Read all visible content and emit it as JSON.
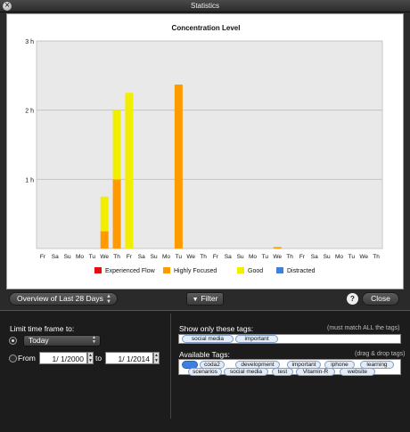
{
  "window": {
    "title": "Statistics"
  },
  "chart_data": {
    "type": "bar",
    "stacked": true,
    "title": "Concentration Level",
    "categories": [
      "Fr",
      "Sa",
      "Su",
      "Mo",
      "Tu",
      "We",
      "Th",
      "Fr",
      "Sa",
      "Su",
      "Mo",
      "Tu",
      "We",
      "Th",
      "Fr",
      "Sa",
      "Su",
      "Mo",
      "Tu",
      "We",
      "Th",
      "Fr",
      "Sa",
      "Su",
      "Mo",
      "Tu",
      "We",
      "Th"
    ],
    "series": [
      {
        "name": "Experienced Flow",
        "color": "#e01010",
        "values": [
          0,
          0,
          0,
          0,
          0,
          0,
          0,
          0,
          0,
          0,
          0,
          0,
          0,
          0,
          0,
          0,
          0,
          0,
          0,
          0,
          0,
          0,
          0,
          0,
          0,
          0,
          0,
          0
        ]
      },
      {
        "name": "Highly Focused",
        "color": "#ff9a00",
        "values": [
          0,
          0,
          0,
          0,
          0,
          0.25,
          1.0,
          0,
          0,
          0,
          0,
          2.37,
          0,
          0,
          0,
          0,
          0,
          0,
          0,
          0.02,
          0,
          0,
          0,
          0,
          0,
          0,
          0,
          0
        ]
      },
      {
        "name": "Good",
        "color": "#f2ee00",
        "values": [
          0,
          0,
          0,
          0,
          0,
          0.5,
          1.0,
          2.25,
          0,
          0,
          0,
          0,
          0,
          0,
          0,
          0,
          0,
          0,
          0,
          0,
          0,
          0,
          0,
          0,
          0,
          0,
          0,
          0
        ]
      },
      {
        "name": "Distracted",
        "color": "#3f7fe0",
        "values": [
          0,
          0,
          0,
          0,
          0,
          0,
          0,
          0,
          0,
          0,
          0,
          0,
          0,
          0,
          0,
          0,
          0,
          0,
          0,
          0,
          0,
          0,
          0,
          0,
          0,
          0,
          0,
          0
        ]
      }
    ],
    "yticks": [
      "1 h",
      "2 h",
      "3 h"
    ],
    "ytick_values": [
      1,
      2,
      3
    ],
    "ylim": [
      0,
      3
    ],
    "grid": true,
    "legend": "bottom"
  },
  "toolbar": {
    "overview_label": "Overview of Last 28 Days",
    "filter_label": "Filter",
    "help_label": "?",
    "close_label": "Close"
  },
  "timeframe": {
    "heading": "Limit time frame to:",
    "preset_value": "Today",
    "from_label": "From",
    "from_value": "1/ 1/2000",
    "to_label": "to",
    "to_value": "1/ 1/2014"
  },
  "tags": {
    "filter_heading": "Show only these tags:",
    "filter_hint": "(must match ALL the tags)",
    "filter_tags": [
      "social media",
      "important"
    ],
    "available_heading": "Available Tags:",
    "available_hint": "(drag & drop tags)",
    "available_tags": [
      "",
      "coda2",
      "development",
      "important",
      "iphone",
      "learning",
      "scenarios",
      "social media",
      "test",
      "Vitamin-R",
      "website"
    ]
  }
}
